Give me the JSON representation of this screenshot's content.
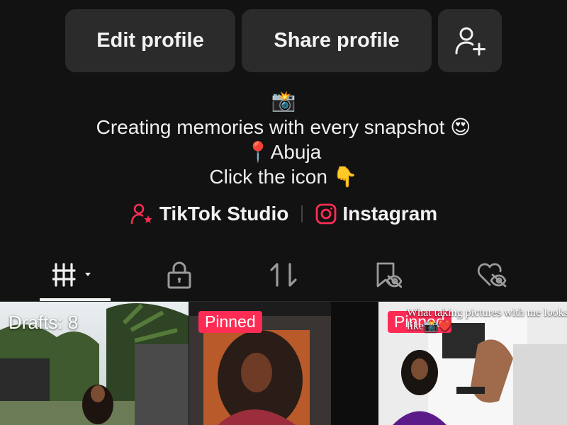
{
  "buttons": {
    "edit_profile": "Edit profile",
    "share_profile": "Share profile",
    "add_friend_icon": "add-user-icon"
  },
  "bio": {
    "line1": "📸",
    "line2_text": "Creating memories with every snapshot",
    "line2_emoji": "😍",
    "line3_emoji": "📍",
    "line3_text": "Abuja",
    "line4_text": "Click the icon",
    "line4_emoji": "👇"
  },
  "links": {
    "studio": "TikTok Studio",
    "instagram": "Instagram"
  },
  "tabs": [
    {
      "icon": "videos-grid-icon",
      "active": true
    },
    {
      "icon": "lock-icon",
      "active": false
    },
    {
      "icon": "repost-icon",
      "active": false
    },
    {
      "icon": "favorites-hidden-icon",
      "active": false
    },
    {
      "icon": "liked-hidden-icon",
      "active": false
    }
  ],
  "grid": [
    {
      "badge": "Drafts: 8"
    },
    {
      "badge": "Pinned"
    },
    {
      "badge": "Pinned",
      "caption": "What taking pictures with me looks like📸❤️"
    }
  ],
  "colors": {
    "background": "#121212",
    "button": "#2b2b2b",
    "accent": "#fe2c55"
  }
}
